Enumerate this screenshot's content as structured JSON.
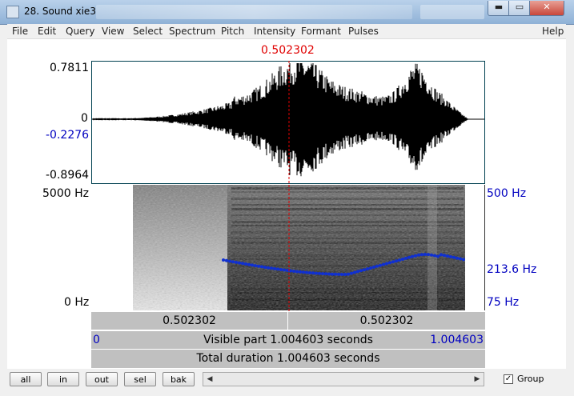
{
  "window": {
    "title": "28. Sound xie3",
    "controls": {
      "minimize": "▬",
      "maximize": "▭",
      "close": "✕"
    }
  },
  "menu": [
    "File",
    "Edit",
    "Query",
    "View",
    "Select",
    "Spectrum",
    "Pitch",
    "Intensity",
    "Formant",
    "Pulses"
  ],
  "help_label": "Help",
  "cursor": {
    "time": "0.502302",
    "time_value": 0.502302
  },
  "waveform": {
    "max_label": "0.7811",
    "zero_label": "0",
    "cursor_amp_label": "-0.2276",
    "min_label": "-0.8964"
  },
  "spectrogram": {
    "top_label": "5000 Hz",
    "bottom_label": "0 Hz",
    "pitch_top_label": "500 Hz",
    "pitch_mid_label": "213.6 Hz",
    "pitch_bottom_label": "75 Hz"
  },
  "timebar": {
    "left_value": "0.502302",
    "right_value": "0.502302",
    "start": "0",
    "visible_text": "Visible part 1.004603 seconds",
    "end": "1.004603",
    "total_text": "Total duration 1.004603 seconds"
  },
  "buttons": {
    "all": "all",
    "in": "in",
    "out": "out",
    "sel": "sel",
    "bak": "bak"
  },
  "scroll_arrows": {
    "left": "◀",
    "right": "▶"
  },
  "group": {
    "label": "Group",
    "checked": true,
    "check_mark": "✓"
  },
  "colors": {
    "cursor": "#e00000",
    "pitch": "#1030d0",
    "labels_blue": "#0000c0"
  }
}
